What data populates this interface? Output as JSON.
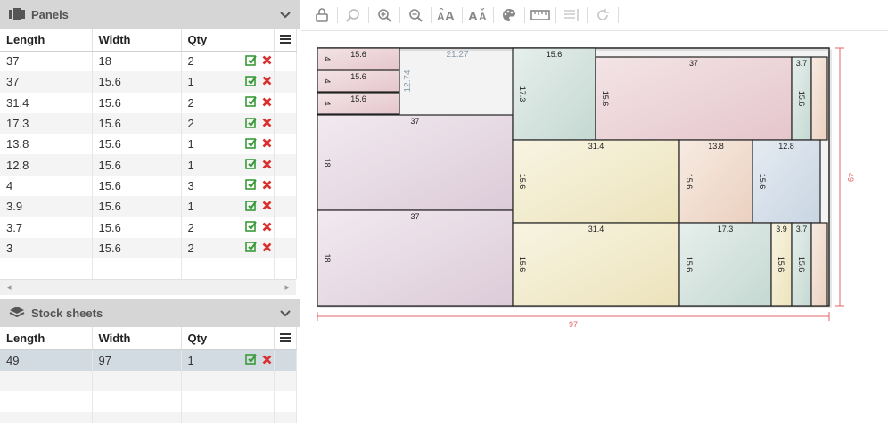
{
  "panels": {
    "title": "Panels",
    "columns": [
      "Length",
      "Width",
      "Qty"
    ],
    "rows": [
      {
        "length": "37",
        "width": "18",
        "qty": "2"
      },
      {
        "length": "37",
        "width": "15.6",
        "qty": "1"
      },
      {
        "length": "31.4",
        "width": "15.6",
        "qty": "2"
      },
      {
        "length": "17.3",
        "width": "15.6",
        "qty": "2"
      },
      {
        "length": "13.8",
        "width": "15.6",
        "qty": "1"
      },
      {
        "length": "12.8",
        "width": "15.6",
        "qty": "1"
      },
      {
        "length": "4",
        "width": "15.6",
        "qty": "3"
      },
      {
        "length": "3.9",
        "width": "15.6",
        "qty": "1"
      },
      {
        "length": "3.7",
        "width": "15.6",
        "qty": "2"
      },
      {
        "length": "3",
        "width": "15.6",
        "qty": "2"
      }
    ]
  },
  "stock": {
    "title": "Stock sheets",
    "columns": [
      "Length",
      "Width",
      "Qty"
    ],
    "rows": [
      {
        "length": "49",
        "width": "97",
        "qty": "1"
      }
    ]
  },
  "diagram": {
    "sheet_width_label": "97",
    "sheet_height_label": "49",
    "offcut_label": "21.27",
    "offcut_side_label": "12.74",
    "pieces": [
      {
        "id": "p1",
        "label_top": "15.6",
        "label_side": "4"
      },
      {
        "id": "p2",
        "label_top": "15.6",
        "label_side": "4"
      },
      {
        "id": "p3",
        "label_top": "15.6",
        "label_side": "4"
      },
      {
        "id": "p4",
        "label_top": "37",
        "label_side": "18"
      },
      {
        "id": "p5",
        "label_top": "37",
        "label_side": "18"
      },
      {
        "id": "p6",
        "label_top": "15.6",
        "label_side": "17.3"
      },
      {
        "id": "p7",
        "label_top": "37",
        "label_side": "15.6"
      },
      {
        "id": "p8",
        "label_top": "3.7",
        "label_side": "15.6"
      },
      {
        "id": "p9",
        "label_top": "",
        "label_side": ""
      },
      {
        "id": "p10",
        "label_top": "31.4",
        "label_side": "15.6"
      },
      {
        "id": "p11",
        "label_top": "13.8",
        "label_side": "15.6"
      },
      {
        "id": "p12",
        "label_top": "12.8",
        "label_side": "15.6"
      },
      {
        "id": "p13",
        "label_top": "31.4",
        "label_side": "15.6"
      },
      {
        "id": "p14",
        "label_top": "17.3",
        "label_side": "15.6"
      },
      {
        "id": "p15",
        "label_top": "3.9",
        "label_side": "15.6"
      },
      {
        "id": "p16",
        "label_top": "3.7",
        "label_side": "15.6"
      },
      {
        "id": "p17",
        "label_top": "",
        "label_side": ""
      }
    ]
  },
  "colors": {
    "accent": "#e06666",
    "check": "#3a9a3a",
    "delete": "#d9302f",
    "header_bg": "#d6d6d6"
  }
}
